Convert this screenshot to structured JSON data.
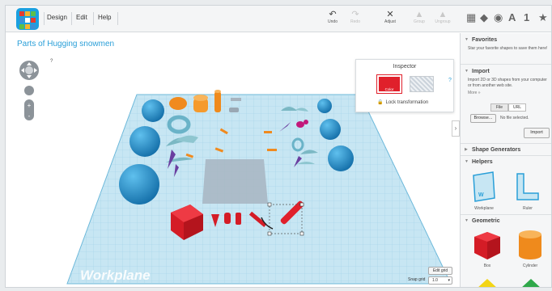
{
  "menu": {
    "design": "Design",
    "edit": "Edit",
    "help": "Help"
  },
  "toolbar": {
    "undo": "Undo",
    "redo": "Redo",
    "adjust": "Adjust",
    "group": "Group",
    "ungroup": "Ungroup"
  },
  "view_icons": {
    "text_letter": "A",
    "number": "1",
    "star": "★"
  },
  "design_title": "Parts of Hugging snowmen",
  "inspector": {
    "title": "Inspector",
    "color_label": "Color",
    "help": "?",
    "lock": "Lock transformation"
  },
  "workplane_label": "Workplane",
  "grid": {
    "edit_grid": "Edit grid",
    "snap_grid_label": "Snap grid",
    "snap_grid_value": "1.0"
  },
  "panel": {
    "favorites_title": "Favorites",
    "favorites_text": "Star your favorite shapes to save them here!",
    "import_title": "Import",
    "import_text": "Import 2D or 3D shapes from your computer or from another web site.",
    "more": "More »",
    "file_tab": "File",
    "url_tab": "URL",
    "browse": "Browse...",
    "no_file": "No file selected.",
    "import_button": "Import",
    "shape_generators": "Shape Generators",
    "helpers_title": "Helpers",
    "helper_workplane": "Workplane",
    "helper_ruler": "Ruler",
    "geometric_title": "Geometric",
    "shape_box": "Box",
    "shape_cylinder": "Cylinder"
  },
  "colors": {
    "brand": "#1aa0e0",
    "selected_red": "#e0202b",
    "shape_blue": "#1e8fc9",
    "shape_orange": "#f08a1e",
    "shape_teal": "#7bb8c4",
    "shape_purple": "#6a3fa0",
    "shape_magenta": "#c2187a"
  }
}
